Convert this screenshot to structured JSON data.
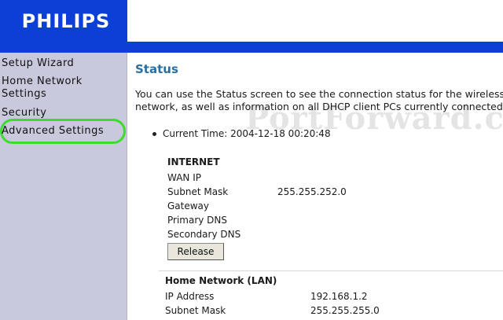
{
  "brand": {
    "logo_text": "PHILIPS"
  },
  "colors": {
    "brand_blue": "#0b3fd6",
    "sidebar_bg": "#c9c9de",
    "title_color": "#2a6fa0",
    "highlight": "#3ddc2a"
  },
  "watermark": "PortForward.com",
  "sidebar": {
    "items": [
      {
        "label": "Setup Wizard"
      },
      {
        "label": "Home Network Settings"
      },
      {
        "label": "Security"
      },
      {
        "label": "Advanced Settings"
      }
    ]
  },
  "main": {
    "title": "Status",
    "intro_line1": "You can use the Status screen to see the connection status for the wireless",
    "intro_line2": "network, as well as information on all DHCP client PCs currently connected to",
    "current_time_label": "Current Time:",
    "current_time_value": "2004-12-18 00:20:48",
    "internet": {
      "title": "INTERNET",
      "rows": [
        {
          "label": "WAN IP",
          "value": ""
        },
        {
          "label": "Subnet Mask",
          "value": "255.255.252.0"
        },
        {
          "label": "Gateway",
          "value": ""
        },
        {
          "label": "Primary DNS",
          "value": ""
        },
        {
          "label": "Secondary DNS",
          "value": ""
        }
      ],
      "release_label": "Release"
    },
    "lan": {
      "title": "Home Network (LAN)",
      "rows": [
        {
          "label": "IP Address",
          "value": "192.168.1.2"
        },
        {
          "label": "Subnet Mask",
          "value": "255.255.255.0"
        }
      ]
    }
  }
}
